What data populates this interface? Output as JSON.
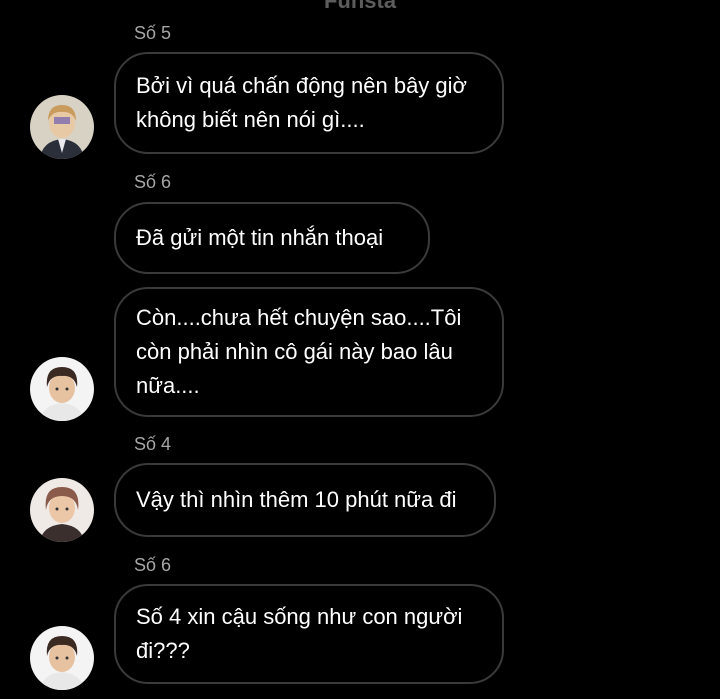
{
  "header": {
    "title": "Funsta"
  },
  "messages": [
    {
      "sender": "Số 5",
      "text": "Bởi vì quá chấn động nên bây giờ không biết nên nói gì...."
    },
    {
      "sender": "Số 6",
      "text": "Đã gửi một tin nhắn thoại"
    },
    {
      "sender": "",
      "text": "Còn....chưa hết chuyện sao....Tôi còn phải nhìn cô gái này bao lâu nữa...."
    },
    {
      "sender": "Số 4",
      "text": "Vậy thì nhìn thêm 10 phút nữa đi"
    },
    {
      "sender": "Số 6",
      "text": "Số 4 xin cậu sống như con người đi???"
    }
  ],
  "colors": {
    "background": "#000000",
    "bubble_border": "#3a3a3a",
    "sender_label": "#a6a6a6",
    "message_text": "#ffffff"
  }
}
